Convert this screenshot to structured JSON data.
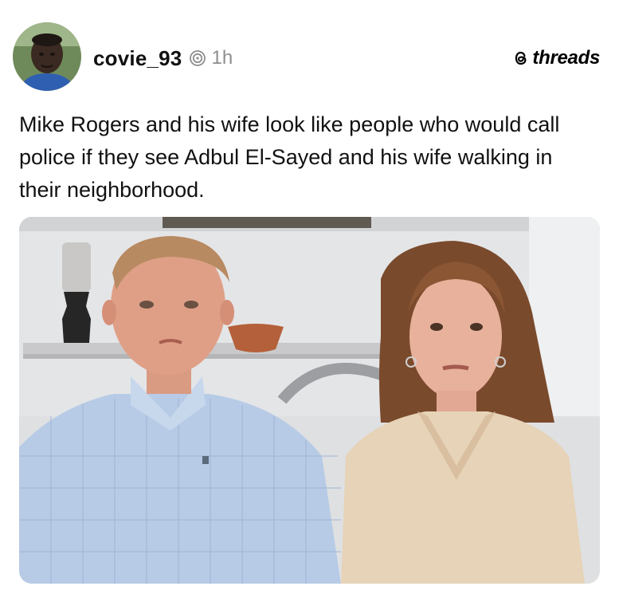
{
  "post": {
    "username": "covie_93",
    "timestamp": "1h",
    "brand": "threads",
    "text": "Mike Rogers and his wife look like people who would call police if they see Adbul El-Sayed and his wife walking in their neighborhood.",
    "icons": {
      "avatar": "user-avatar-photo",
      "repost": "repost-spiral-icon",
      "brand": "threads-logo-icon"
    },
    "media": {
      "kind": "photo",
      "description_icon": "couple-photo"
    }
  },
  "colors": {
    "text": "#111111",
    "timestamp": "#8e8e8e",
    "shirt_blue": "#b7cbe6",
    "sweater_beige": "#e6d3b8",
    "background_wall": "#e4e5e7"
  }
}
